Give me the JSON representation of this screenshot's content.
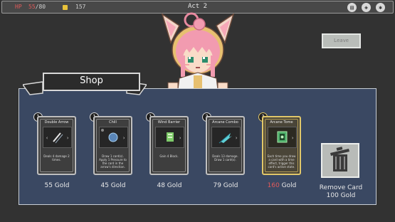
{
  "topbar": {
    "hp_label": "HP",
    "hp_current": "55",
    "hp_max": "/80",
    "gold": "157",
    "act": "Act 2",
    "icons": [
      "deck-icon",
      "map-icon",
      "settings-icon"
    ]
  },
  "leave_label": "Leave",
  "shop_title": "Shop",
  "cards": [
    {
      "cost": "1",
      "name": "Double Arrow",
      "desc": "Deals 4 damage 2 times.",
      "price": "55 Gold",
      "affordable": true,
      "rare": false
    },
    {
      "cost": "1",
      "name": "Chill",
      "desc": "Draw 1 card(s). Apply 1 Pressure to the card in the arrow's direction.",
      "price": "45 Gold",
      "affordable": true,
      "rare": false
    },
    {
      "cost": "1",
      "name": "Wind Barrier",
      "desc": "Gain 4 Block.",
      "price": "48 Gold",
      "affordable": true,
      "rare": false
    },
    {
      "cost": "3",
      "name": "Arcane Combo",
      "desc": "Deals 13 damage. Draw 1 card(s).",
      "price": "79 Gold",
      "affordable": true,
      "rare": false
    },
    {
      "cost": "3",
      "name": "Arcane Tome",
      "desc": "Each time you draw a card with a time effect, trigger this card's active state.",
      "price_value": "160",
      "price_unit": " Gold",
      "affordable": false,
      "rare": true
    }
  ],
  "remove": {
    "title": "Remove Card",
    "price": "100 Gold"
  },
  "colors": {
    "bg": "#323232",
    "panel": "#3a4862",
    "hp": "#e05a5a",
    "unaffordable": "#e25a5a",
    "rare_border": "#e2c86a"
  }
}
